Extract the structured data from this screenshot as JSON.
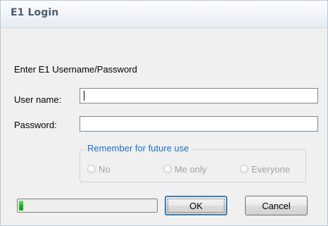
{
  "window": {
    "title": "E1 Login"
  },
  "form": {
    "instruction": "Enter E1 Username/Password",
    "username": {
      "label": "User name:",
      "value": ""
    },
    "password": {
      "label": "Password:",
      "value": ""
    }
  },
  "remember": {
    "legend": "Remember for future use",
    "options": [
      {
        "label": "No",
        "selected": false,
        "enabled": false
      },
      {
        "label": "Me only",
        "selected": false,
        "enabled": false
      },
      {
        "label": "Everyone",
        "selected": false,
        "enabled": false
      }
    ]
  },
  "progress": {
    "fraction": 0.03,
    "color": "#22b322"
  },
  "buttons": {
    "ok_label": "OK",
    "cancel_label": "Cancel"
  },
  "colors": {
    "legend": "#1c6ec9",
    "title": "#4e5c6d",
    "disabled_text": "#a3a3a3"
  }
}
